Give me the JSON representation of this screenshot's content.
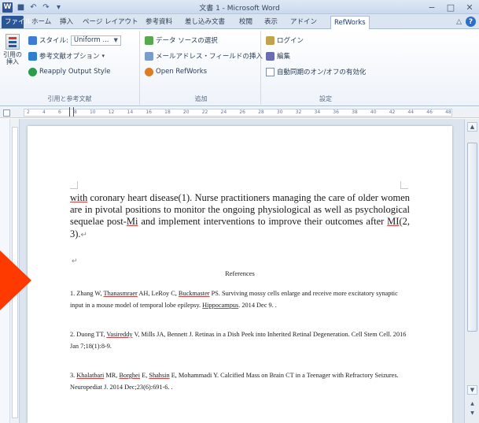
{
  "titlebar": {
    "app_icon": "W",
    "title": "文書 1 - Microsoft Word",
    "buttons": {
      "minimize": "−",
      "maximize": "□",
      "close": "✕"
    }
  },
  "tabs": [
    {
      "label": "ファイル",
      "kind": "file"
    },
    {
      "label": "ホーム"
    },
    {
      "label": "挿入"
    },
    {
      "label": "ページ レイアウト"
    },
    {
      "label": "参考資料"
    },
    {
      "label": "差し込み文書"
    },
    {
      "label": "校閲"
    },
    {
      "label": "表示"
    },
    {
      "label": "アドイン"
    },
    {
      "label": "RefWorks",
      "active": true
    }
  ],
  "ribbon": {
    "citation_group": {
      "insert_citation_label": "引用の挿入",
      "style_label": "スタイル:",
      "style_value": "Uniform ...",
      "bibliography_options": "参考文献オプション",
      "reapply_output_style": "Reapply Output Style",
      "group_label": "引用と参考文献"
    },
    "extras_group": {
      "data_source": "データ ソースの選択",
      "insert_field": "メールアドレス・フィールドの挿入",
      "open_refworks": "Open RefWorks",
      "group_label": "追加"
    },
    "settings_group": {
      "login": "ログイン",
      "edit": "編集",
      "auto_update": "自動同期のオン/オフの有効化",
      "group_label": "設定"
    }
  },
  "ruler": {
    "numbers": [
      "2",
      "4",
      "6",
      "8",
      "10",
      "12",
      "14",
      "16",
      "18",
      "20",
      "22",
      "24",
      "26",
      "28",
      "30",
      "32",
      "34",
      "36",
      "38",
      "40",
      "42",
      "44",
      "46",
      "48"
    ]
  },
  "document": {
    "paragraph": {
      "w1": "with",
      "t1": " coronary heart disease(1). Nurse practitioners managing the care of older women are in pivotal positions to monitor the ongoing physiological as well as psychological sequelae post-",
      "w2": "Mi",
      "t2": " and implement interventions to improve their outcomes after ",
      "w3": "MI",
      "t3": "(2, 3).",
      "mark": "↵"
    },
    "empty_mark": "↵",
    "references_heading": "References",
    "references": [
      {
        "pre": "1. Zhang W, ",
        "sq": "Thanasmraer",
        "mid": " AH, LeRoy C, ",
        "sq2": "Buckmaster",
        "post": " PS. Surviving mossy cells enlarge and receive more excitatory synaptic input in a mouse model of temporal lobe epilepsy. ",
        "sq3": "Hippocampus",
        "tail": ". 2014 Dec 9. ."
      },
      {
        "pre": "2. Duong TT, ",
        "sq": "Vasireddy",
        "mid": " V, Mills JA, Bennett J. Retinas in a Dish Peek into Inherited Retinal Degeneration. Cell Stem Cell. 2016 Jan 7;18(1):8-9."
      },
      {
        "pre": "3. ",
        "sq": "Khalatbari",
        "mid": " MR, ",
        "sq2": "Borghei",
        "post": " E, ",
        "sq3": "Shahsin",
        "tail": " E, Mohammadi Y. Calcified Mass on Brain CT in a Teenager with Refractory Seizures. Neuropediat J. 2014 Dec;23(6):691-6. ."
      }
    ]
  },
  "scrollbar": {
    "up": "▲",
    "down": "▼",
    "prev": "▲",
    "next": "▼"
  },
  "colors": {
    "accent": "#2b579a",
    "arrow": "#ff3a00"
  }
}
